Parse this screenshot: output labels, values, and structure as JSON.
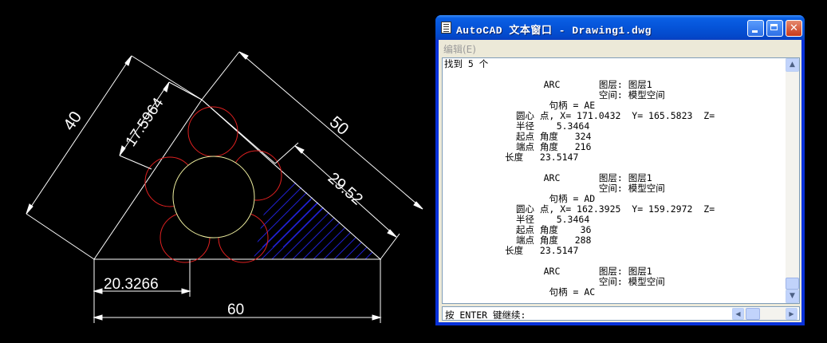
{
  "drawing": {
    "dimensions": {
      "dim_40": "40",
      "dim_17": "17.5964",
      "dim_50": "50",
      "dim_29": "29.52",
      "dim_20": "20.3266",
      "dim_60": "60"
    },
    "colors": {
      "outline": "#ffffff",
      "arcs": "#e02020",
      "inner_circle": "#f0f0a0",
      "hatch": "#2020d0"
    }
  },
  "window": {
    "title": "AutoCAD 文本窗口 - Drawing1.dwg",
    "menu": "编辑(E)",
    "controls": {
      "minimize": "minimize-icon",
      "maximize": "maximize-icon",
      "close": "close-icon"
    },
    "output_lines": [
      "找到 5 个",
      "",
      "                  ARC       图层: 图层1",
      "                            空间: 模型空间",
      "                   句柄 = AE",
      "             圆心 点, X= 171.0432  Y= 165.5823  Z=",
      "             半径    5.3464",
      "             起点 角度   324",
      "             端点 角度   216",
      "           长度   23.5147",
      "",
      "                  ARC       图层: 图层1",
      "                            空间: 模型空间",
      "                   句柄 = AD",
      "             圆心 点, X= 162.3925  Y= 159.2972  Z=",
      "             半径    5.3464",
      "             起点 角度    36",
      "             端点 角度   288",
      "           长度   23.5147",
      "",
      "                  ARC       图层: 图层1",
      "                            空间: 模型空间",
      "                   句柄 = AC"
    ],
    "prompt": "按 ENTER 键继续:"
  }
}
